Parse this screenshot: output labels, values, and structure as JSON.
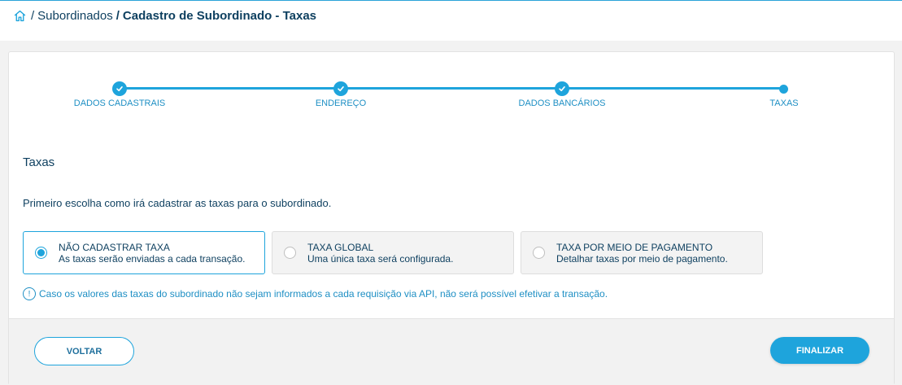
{
  "breadcrumb": {
    "sep1": "/",
    "link": "Subordinados",
    "sep2": "/",
    "current": "Cadastro de Subordinado - Taxas"
  },
  "stepper": {
    "steps": [
      {
        "label": "DADOS CADASTRAIS",
        "status": "done"
      },
      {
        "label": "ENDEREÇO",
        "status": "done"
      },
      {
        "label": "DADOS BANCÁRIOS",
        "status": "done"
      },
      {
        "label": "TAXAS",
        "status": "current"
      }
    ]
  },
  "section": {
    "title": "Taxas",
    "intro": "Primeiro escolha como irá cadastrar as taxas para o subordinado."
  },
  "options": [
    {
      "title": "NÃO CADASTRAR TAXA",
      "subtitle": "As taxas serão enviadas a cada transação.",
      "selected": true
    },
    {
      "title": "TAXA GLOBAL",
      "subtitle": "Uma única taxa será configurada.",
      "selected": false
    },
    {
      "title": "TAXA POR MEIO DE PAGAMENTO",
      "subtitle": "Detalhar taxas por meio de pagamento.",
      "selected": false
    }
  ],
  "warning": {
    "icon": "!",
    "text": "Caso os valores das taxas do subordinado não sejam informados a cada requisição via API, não será possível efetivar a transação."
  },
  "footer": {
    "back_label": "VOLTAR",
    "finish_label": "FINALIZAR"
  },
  "colors": {
    "accent": "#1ea4dc",
    "text_dark": "#0d3f5f"
  }
}
